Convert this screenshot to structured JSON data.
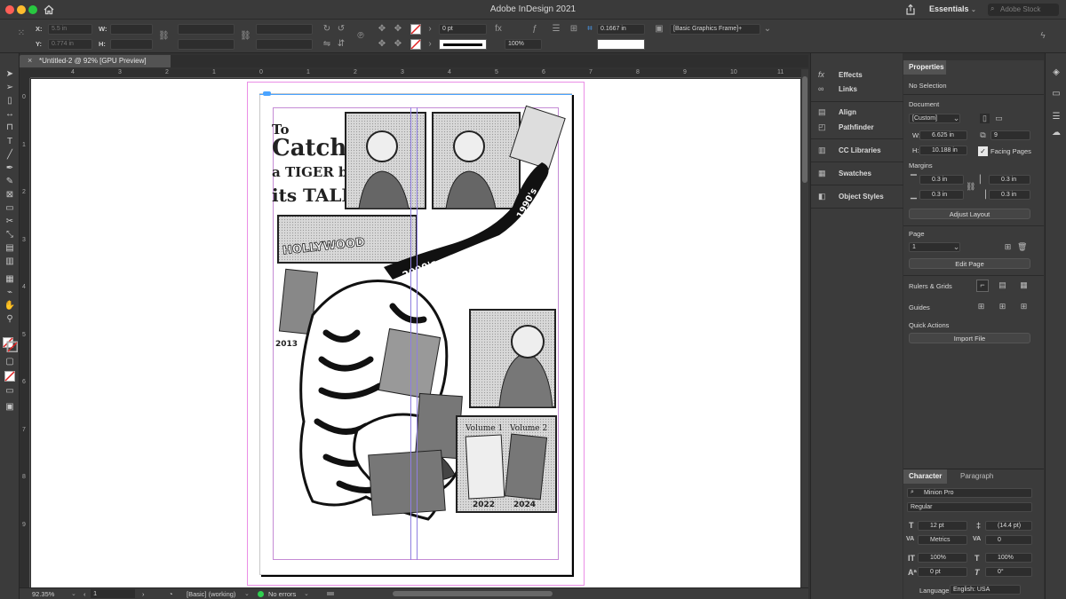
{
  "app": {
    "title": "Adobe InDesign 2021",
    "workspace": "Essentials",
    "workspace_chevron": "⌄",
    "stock_placeholder": "Adobe Stock"
  },
  "controlbar": {
    "x_label": "X:",
    "x_value": "5.5 in",
    "y_label": "Y:",
    "y_value": "0.774 in",
    "w_label": "W:",
    "h_label": "H:",
    "stroke_weight": "0 pt",
    "opacity": "100%",
    "value_field": "0.1667 in",
    "object_style": "[Basic Graphics Frame]+"
  },
  "document": {
    "tab_title": "*Untitled-2 @ 92% [GPU Preview]",
    "close_glyph": "×"
  },
  "rulers": {
    "horizontal": [
      "4",
      "3",
      "2",
      "1",
      "0",
      "1",
      "2",
      "3",
      "4",
      "5",
      "6",
      "7",
      "8",
      "9",
      "10",
      "11"
    ],
    "vertical": [
      "0",
      "1",
      "2",
      "3",
      "4",
      "5",
      "6",
      "7",
      "8",
      "9"
    ]
  },
  "statusbar": {
    "zoom": "92.35%",
    "page": "1",
    "style": "[Basic] (working)",
    "errors": "No errors"
  },
  "mid_panels": [
    {
      "label": "Effects",
      "icon": "fx-icon"
    },
    {
      "label": "Links",
      "icon": "links-icon"
    },
    {
      "label": "Align",
      "icon": "align-icon"
    },
    {
      "label": "Pathfinder",
      "icon": "pathfinder-icon"
    },
    {
      "label": "CC Libraries",
      "icon": "cc-libraries-icon"
    },
    {
      "label": "Swatches",
      "icon": "swatches-icon"
    },
    {
      "label": "Object Styles",
      "icon": "object-styles-icon"
    }
  ],
  "properties": {
    "tab": "Properties",
    "selection": "No Selection",
    "document_heading": "Document",
    "preset": "[Custom]",
    "w_label": "W:",
    "w_value": "6.625 in",
    "h_label": "H:",
    "h_value": "10.188 in",
    "pages_value": "9",
    "facing_pages": "Facing Pages",
    "margins_heading": "Margins",
    "margin_top": "0.3 in",
    "margin_bottom": "0.3 in",
    "margin_left": "0.3 in",
    "margin_right": "0.3 in",
    "adjust_layout": "Adjust Layout",
    "page_heading": "Page",
    "page_value": "1",
    "edit_page": "Edit Page",
    "rulers_grids": "Rulers & Grids",
    "guides": "Guides",
    "quick_actions": "Quick Actions",
    "import_file": "Import File"
  },
  "character": {
    "tab_active": "Character",
    "tab_inactive": "Paragraph",
    "font": "Minion Pro",
    "style": "Regular",
    "size": "12 pt",
    "leading": "(14.4 pt)",
    "kerning": "Metrics",
    "tracking": "0",
    "vscale": "100%",
    "hscale": "100%",
    "baseline": "0 pt",
    "skew": "0°",
    "language_label": "Language:",
    "language": "English: USA"
  },
  "artwork": {
    "title_line1": "To",
    "title_line2": "Catch",
    "title_line3": "a TIGER by",
    "title_line4": "its TALE",
    "hollywood": "HOLLYWOOD",
    "tail_2000": "2000's",
    "tail_1990": "1990's",
    "year_2013": "2013",
    "vol1": "Volume 1",
    "vol2": "Volume 2",
    "year_2022": "2022",
    "year_2024": "2024"
  },
  "colors": {
    "accent_blue": "#4aa3ff",
    "guide_magenta": "#ea8ee6",
    "guide_purple": "#c58bd5",
    "status_ok": "#2fcf4f"
  }
}
